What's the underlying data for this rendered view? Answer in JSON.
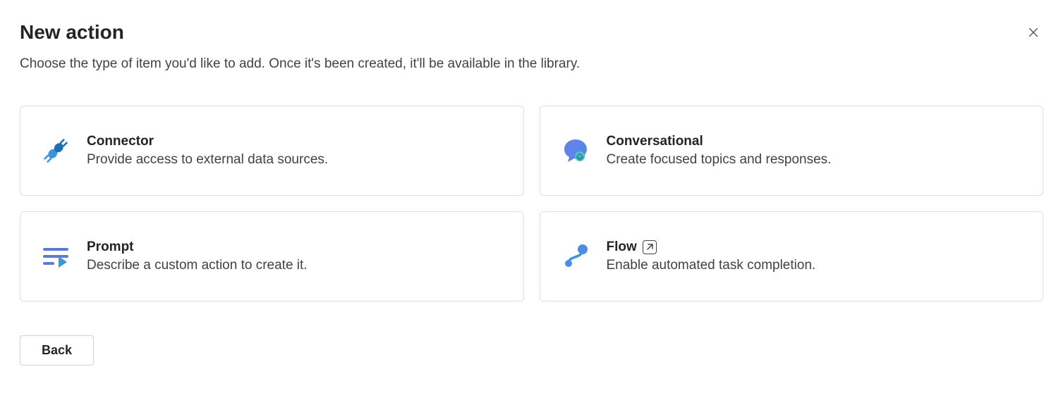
{
  "dialog": {
    "title": "New action",
    "subtitle": "Choose the type of item you'd like to add. Once it's been created, it'll be available in the library.",
    "back_label": "Back"
  },
  "cards": {
    "connector": {
      "title": "Connector",
      "desc": "Provide access to external data sources."
    },
    "conversational": {
      "title": "Conversational",
      "desc": "Create focused topics and responses."
    },
    "prompt": {
      "title": "Prompt",
      "desc": "Describe a custom action to create it."
    },
    "flow": {
      "title": "Flow",
      "desc": "Enable automated task completion."
    }
  }
}
